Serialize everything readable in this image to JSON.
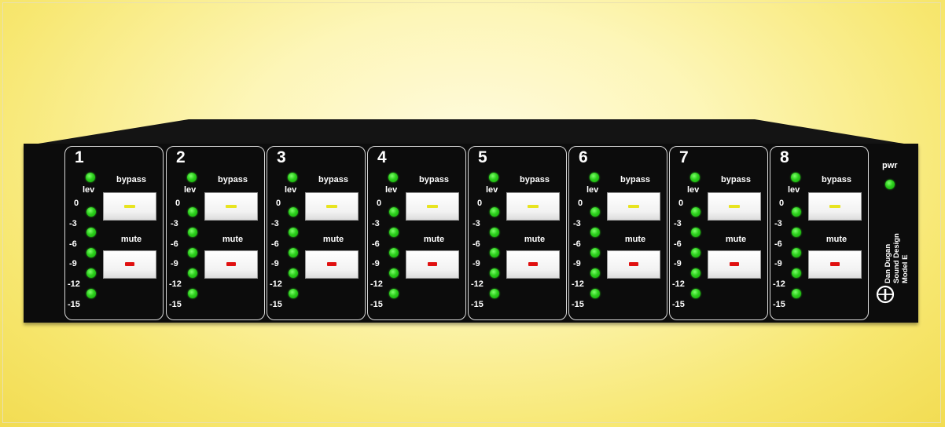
{
  "colors": {
    "background": "#f7e770",
    "panel": "#0c0c0c",
    "led": "#2ccf1c",
    "bypass_indicator": "#e8e420",
    "mute_indicator": "#e01010"
  },
  "channels": [
    {
      "number": "1",
      "lev_label": "lev",
      "bypass_label": "bypass",
      "mute_label": "mute"
    },
    {
      "number": "2",
      "lev_label": "lev",
      "bypass_label": "bypass",
      "mute_label": "mute"
    },
    {
      "number": "3",
      "lev_label": "lev",
      "bypass_label": "bypass",
      "mute_label": "mute"
    },
    {
      "number": "4",
      "lev_label": "lev",
      "bypass_label": "bypass",
      "mute_label": "mute"
    },
    {
      "number": "5",
      "lev_label": "lev",
      "bypass_label": "bypass",
      "mute_label": "mute"
    },
    {
      "number": "6",
      "lev_label": "lev",
      "bypass_label": "bypass",
      "mute_label": "mute"
    },
    {
      "number": "7",
      "lev_label": "lev",
      "bypass_label": "bypass",
      "mute_label": "mute"
    },
    {
      "number": "8",
      "lev_label": "lev",
      "bypass_label": "bypass",
      "mute_label": "mute"
    }
  ],
  "scale_labels": [
    "0",
    "-3",
    "-6",
    "-9",
    "-12",
    "-15"
  ],
  "power": {
    "label": "pwr"
  },
  "brand": {
    "line1": "Dan Dugan",
    "line2": "Sound Design",
    "line3": "Model E"
  },
  "icons": {
    "logo": "dan-dugan-logo-icon",
    "led": "green-led-icon"
  }
}
